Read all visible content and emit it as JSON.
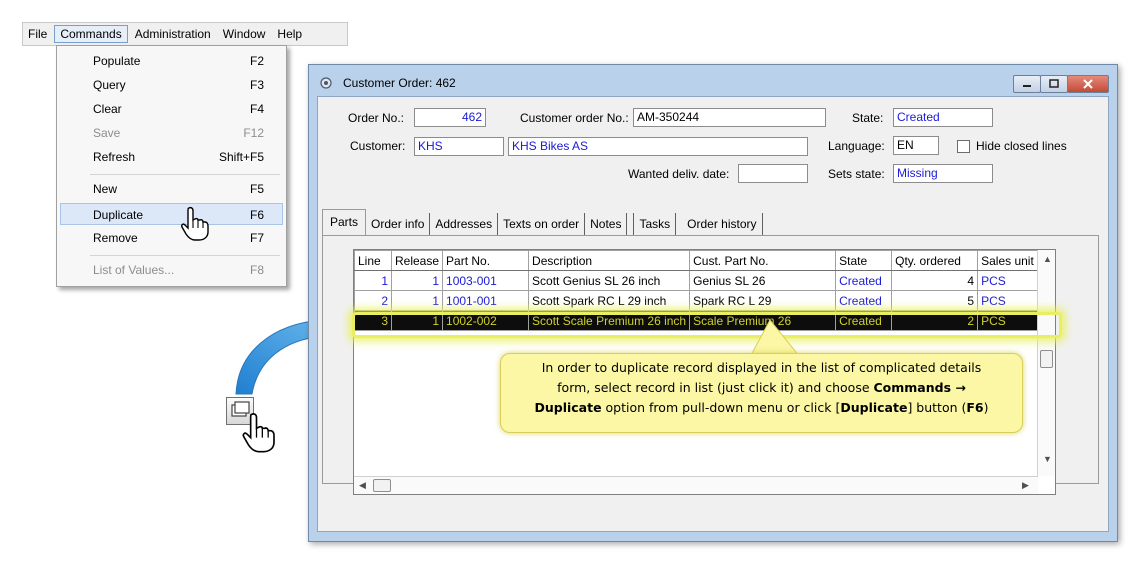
{
  "menubar": {
    "items": [
      {
        "label": "File"
      },
      {
        "label": "Commands"
      },
      {
        "label": "Administration"
      },
      {
        "label": "Window"
      },
      {
        "label": "Help"
      }
    ]
  },
  "commands_menu": {
    "items": [
      {
        "label": "Populate",
        "shortcut": "F2"
      },
      {
        "label": "Query",
        "shortcut": "F3"
      },
      {
        "label": "Clear",
        "shortcut": "F4"
      },
      {
        "label": "Save",
        "shortcut": "F12"
      },
      {
        "label": "Refresh",
        "shortcut": "Shift+F5"
      },
      {
        "label": "New",
        "shortcut": "F5"
      },
      {
        "label": "Duplicate",
        "shortcut": "F6"
      },
      {
        "label": "Remove",
        "shortcut": "F7"
      },
      {
        "label": "List of Values...",
        "shortcut": "F8"
      }
    ]
  },
  "window": {
    "title": "Customer Order: 462"
  },
  "form": {
    "order_no_label": "Order No.:",
    "order_no": "462",
    "customer_order_no_label": "Customer order No.:",
    "customer_order_no": "AM-350244",
    "state_label": "State:",
    "state": "Created",
    "customer_label": "Customer:",
    "customer_id": "KHS",
    "customer_name": "KHS Bikes AS",
    "language_label": "Language:",
    "language": "EN",
    "hide_closed_label": "Hide closed lines",
    "wanted_deliv_label": "Wanted deliv. date:",
    "wanted_deliv": "",
    "sets_state_label": "Sets state:",
    "sets_state": "Missing"
  },
  "tabs": [
    {
      "label": "Parts"
    },
    {
      "label": "Order info"
    },
    {
      "label": "Addresses"
    },
    {
      "label": "Texts on order"
    },
    {
      "label": "Notes"
    },
    {
      "label": "Tasks"
    },
    {
      "label": "Order history"
    }
  ],
  "grid": {
    "columns": [
      "Line",
      "Release",
      "Part No.",
      "Description",
      "Cust. Part No.",
      "State",
      "Qty. ordered",
      "Sales unit"
    ],
    "rows": [
      {
        "line": "1",
        "release": "1",
        "part_no": "1003-001",
        "description": "Scott Genius SL 26 inch",
        "cust_part_no": "Genius SL 26",
        "state": "Created",
        "qty": "4",
        "unit": "PCS"
      },
      {
        "line": "2",
        "release": "1",
        "part_no": "1001-001",
        "description": "Scott Spark RC L 29 inch",
        "cust_part_no": "Spark RC L 29",
        "state": "Created",
        "qty": "5",
        "unit": "PCS"
      },
      {
        "line": "3",
        "release": "1",
        "part_no": "1002-002",
        "description": "Scott Scale Premium 26 inch",
        "cust_part_no": "Scale Premium 26",
        "state": "Created",
        "qty": "2",
        "unit": "PCS"
      }
    ]
  },
  "callout": {
    "line1": "In order to duplicate record displayed in the list of complicated details",
    "line2a": "form, select record in list (just click it) and choose ",
    "line2b": "Commands →",
    "line3a": "Duplicate",
    "line3b": " option from pull-down menu or click [",
    "line3c": "Duplicate",
    "line3d": "] button (",
    "line3e": "F6",
    "line3f": ")"
  },
  "colors": {
    "field_text": "#1a1ad6",
    "selected_row_bg": "#0d0d0d",
    "selected_row_text": "#cfd12a",
    "callout_bg": "#fbf7a5",
    "arrow_blue": "#3d9ee0"
  }
}
